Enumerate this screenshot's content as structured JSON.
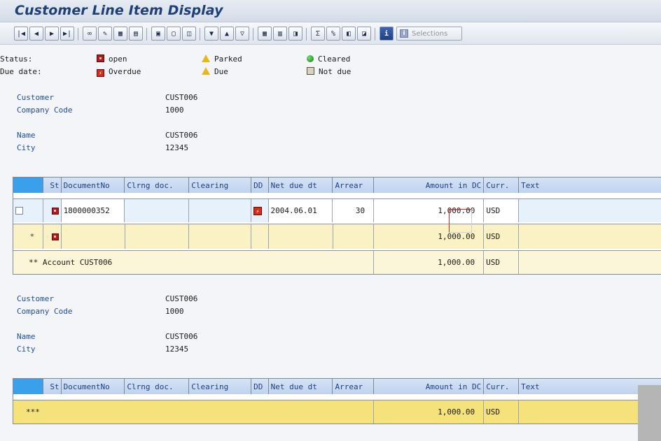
{
  "window": {
    "title": "Customer Line Item Display"
  },
  "toolbar": {
    "buttons": [
      {
        "name": "first-page-icon",
        "glyph": "|◀"
      },
      {
        "name": "prev-page-icon",
        "glyph": "◀"
      },
      {
        "name": "next-page-icon",
        "glyph": "▶"
      },
      {
        "name": "last-page-icon",
        "glyph": "▶|"
      },
      {
        "name": "glasses-icon",
        "glyph": "∞"
      },
      {
        "name": "pencil-icon",
        "glyph": "✎"
      },
      {
        "name": "mass-change-icon",
        "glyph": "▦"
      },
      {
        "name": "document-icon",
        "glyph": "▤"
      },
      {
        "name": "select-all-icon",
        "glyph": "▣"
      },
      {
        "name": "deselect-icon",
        "glyph": "▢"
      },
      {
        "name": "details-icon",
        "glyph": "◫"
      },
      {
        "name": "filter-icon",
        "glyph": "▼"
      },
      {
        "name": "sort-asc-icon",
        "glyph": "▲"
      },
      {
        "name": "sort-desc-icon",
        "glyph": "▽"
      },
      {
        "name": "layout-icon",
        "glyph": "▦"
      },
      {
        "name": "columns-icon",
        "glyph": "▥"
      },
      {
        "name": "export-icon",
        "glyph": "◨"
      },
      {
        "name": "total-icon",
        "glyph": "Σ"
      },
      {
        "name": "subtotal-icon",
        "glyph": "%"
      },
      {
        "name": "save-layout-icon",
        "glyph": "◧"
      },
      {
        "name": "variant-icon",
        "glyph": "◪"
      },
      {
        "name": "info-icon",
        "glyph": "i"
      }
    ],
    "selections_label": "Selections"
  },
  "legend": {
    "status_label": "Status:",
    "due_label": "Due date:",
    "open": "open",
    "parked": "Parked",
    "cleared": "Cleared",
    "overdue": "Overdue",
    "due": "Due",
    "not_due": "Not due"
  },
  "block1": {
    "customer_label": "Customer",
    "customer_value": "CUST006",
    "company_label": "Company Code",
    "company_value": "1000",
    "name_label": "Name",
    "name_value": "CUST006",
    "city_label": "City",
    "city_value": "12345"
  },
  "block2": {
    "customer_label": "Customer",
    "customer_value": "CUST006",
    "company_label": "Company Code",
    "company_value": "1000",
    "name_label": "Name",
    "name_value": "CUST006",
    "city_label": "City",
    "city_value": "12345"
  },
  "columns": {
    "st": "St",
    "doc": "DocumentNo",
    "clrdoc": "Clrng doc.",
    "clearing": "Clearing",
    "dd": "DD",
    "netdue": "Net due dt",
    "arrear": "Arrear",
    "amount": "Amount in DC",
    "curr": "Curr.",
    "text": "Text"
  },
  "table1": {
    "item": {
      "doc": "1800000352",
      "clrdoc": "",
      "clearing": "",
      "netdue": "2004.06.01",
      "arrear": "30",
      "amount": "1,000.00",
      "curr": "USD",
      "text": ""
    },
    "subtotal": {
      "marker": "*",
      "amount": "1,000.00",
      "curr": "USD"
    },
    "account_total": {
      "label": "** Account CUST006",
      "amount": "1,000.00",
      "curr": "USD"
    }
  },
  "table2": {
    "grand_total": {
      "label": "***",
      "amount": "1,000.00",
      "curr": "USD"
    }
  }
}
